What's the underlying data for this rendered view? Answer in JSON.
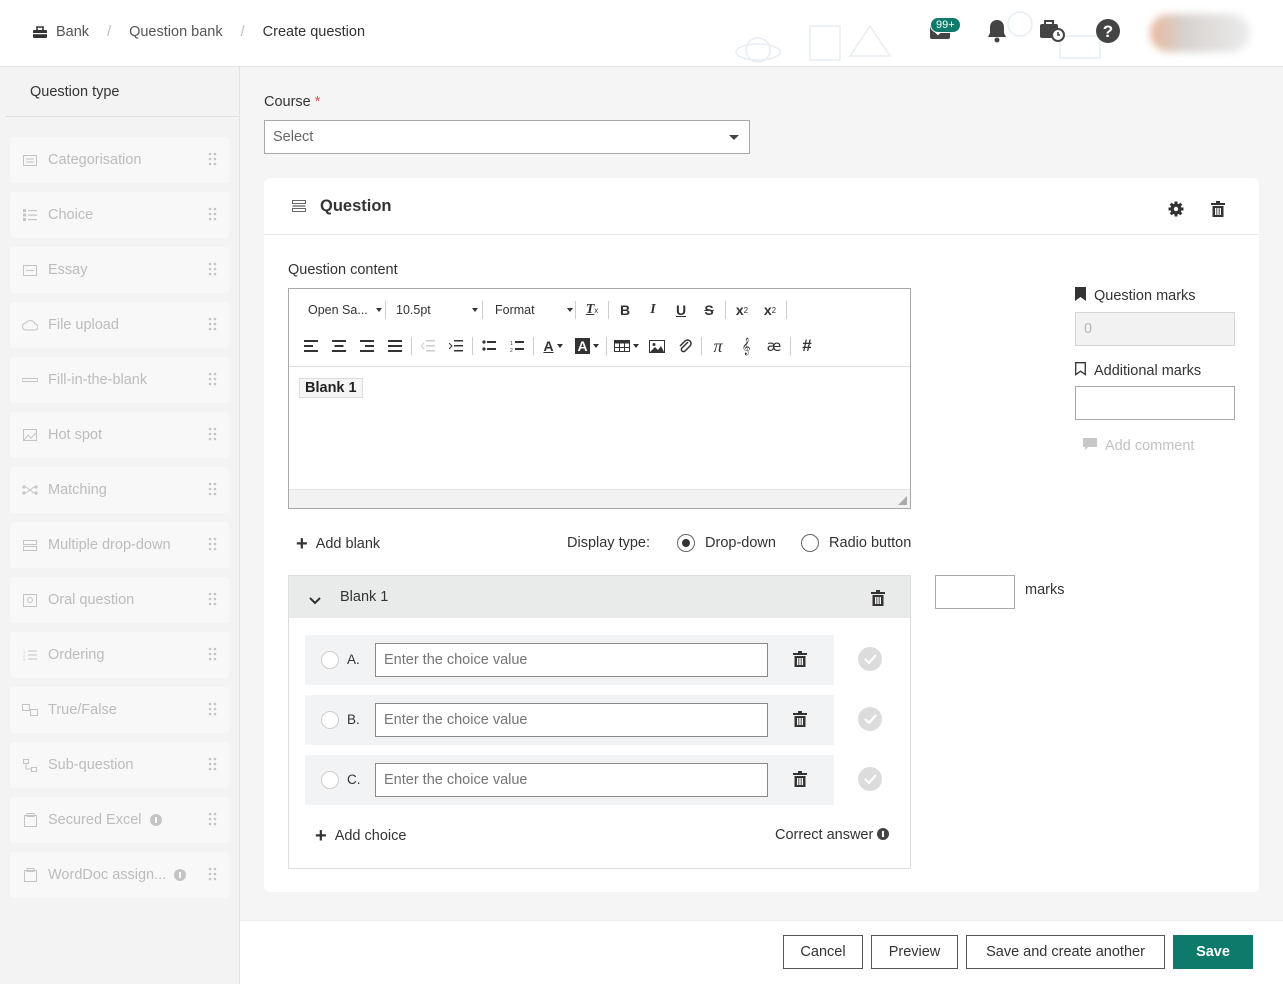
{
  "breadcrumb": {
    "items": [
      "Bank",
      "Question bank",
      "Create question"
    ]
  },
  "header": {
    "notification_badge": "99+"
  },
  "sidebar": {
    "title": "Question type",
    "items": [
      {
        "label": "Categorisation",
        "icon": "categorisation-icon"
      },
      {
        "label": "Choice",
        "icon": "choice-icon"
      },
      {
        "label": "Essay",
        "icon": "essay-icon"
      },
      {
        "label": "File upload",
        "icon": "file-upload-icon"
      },
      {
        "label": "Fill-in-the-blank",
        "icon": "fill-blank-icon"
      },
      {
        "label": "Hot spot",
        "icon": "hot-spot-icon"
      },
      {
        "label": "Matching",
        "icon": "matching-icon"
      },
      {
        "label": "Multiple drop-down",
        "icon": "multiple-dropdown-icon"
      },
      {
        "label": "Oral question",
        "icon": "oral-question-icon"
      },
      {
        "label": "Ordering",
        "icon": "ordering-icon"
      },
      {
        "label": "True/False",
        "icon": "true-false-icon"
      },
      {
        "label": "Sub-question",
        "icon": "sub-question-icon"
      },
      {
        "label": "Secured Excel",
        "icon": "secured-excel-icon",
        "info": true
      },
      {
        "label": "WordDoc assign...",
        "icon": "worddoc-icon",
        "info": true
      }
    ]
  },
  "course": {
    "label": "Course",
    "required_mark": "*",
    "value": "Select"
  },
  "question": {
    "title": "Question",
    "content_label": "Question content",
    "toolbar": {
      "font": "Open Sa...",
      "size": "10.5pt",
      "format": "Format"
    },
    "blank_chip": "Blank 1",
    "marks_label": "Question marks",
    "marks_value": "0",
    "additional_marks_label": "Additional marks",
    "add_comment": "Add comment",
    "add_blank": "Add blank",
    "display_type_label": "Display type:",
    "display_options": [
      "Drop-down",
      "Radio button"
    ],
    "display_selected": "Drop-down"
  },
  "blank": {
    "title": "Blank 1",
    "marks_label": "marks",
    "choices": [
      {
        "letter": "A.",
        "placeholder": "Enter the choice value"
      },
      {
        "letter": "B.",
        "placeholder": "Enter the choice value"
      },
      {
        "letter": "C.",
        "placeholder": "Enter the choice value"
      }
    ],
    "add_choice": "Add choice",
    "correct_answer": "Correct answer"
  },
  "footer": {
    "cancel": "Cancel",
    "preview": "Preview",
    "save_another": "Save and create another",
    "save": "Save"
  },
  "colors": {
    "primary": "#0d7a6c",
    "required": "#d9534f"
  }
}
